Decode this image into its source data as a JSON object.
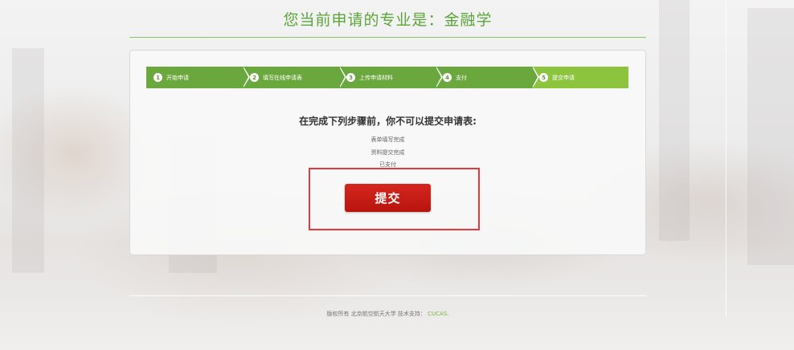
{
  "header": {
    "title": "您当前申请的专业是：金融学"
  },
  "steps": [
    {
      "num": "1",
      "label": "开始申请"
    },
    {
      "num": "2",
      "label": "填写在线申请表"
    },
    {
      "num": "3",
      "label": "上传申请材料"
    },
    {
      "num": "4",
      "label": "支付"
    },
    {
      "num": "5",
      "label": "提交申请"
    }
  ],
  "active_step": 5,
  "notice": {
    "title": "在完成下列步骤前，你不可以提交申请表:",
    "requirements": [
      "表单填写完成",
      "资料提交完成",
      "已支付"
    ]
  },
  "submit_button": {
    "label": "提交"
  },
  "footer": {
    "text": "版权所有 北京航空航天大学 技术支持：",
    "link_label": "CUCAS."
  },
  "colors": {
    "accent_green": "#6aa83d",
    "active_step_green": "#8cc43e",
    "submit_red": "#c81b16",
    "highlight_border": "#e03a3a"
  }
}
